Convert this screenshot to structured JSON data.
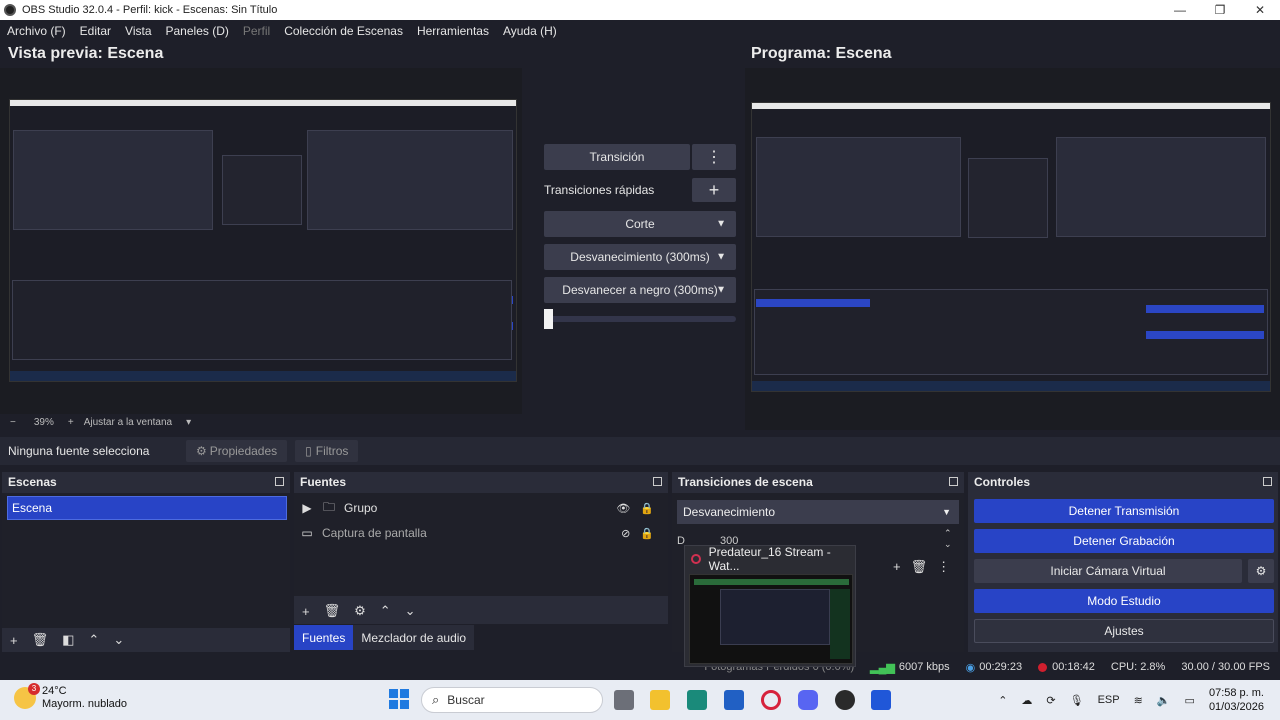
{
  "window": {
    "title": "OBS Studio 32.0.4 - Perfil: kick - Escenas: Sin Título",
    "controls": [
      "—",
      "❐",
      "✕"
    ]
  },
  "menu": [
    {
      "label": "Archivo (F)",
      "disabled": false
    },
    {
      "label": "Editar",
      "disabled": false
    },
    {
      "label": "Vista",
      "disabled": false
    },
    {
      "label": "Paneles (D)",
      "disabled": false
    },
    {
      "label": "Perfil",
      "disabled": true
    },
    {
      "label": "Colección de Escenas",
      "disabled": false
    },
    {
      "label": "Herramientas",
      "disabled": false
    },
    {
      "label": "Ayuda (H)",
      "disabled": false
    }
  ],
  "preview": {
    "title": "Vista previa: Escena"
  },
  "program": {
    "title": "Programa: Escena"
  },
  "transition_panel": {
    "transition_label": "Transición",
    "menu_icon": "⋮",
    "quick_label": "Transiciones rápidas",
    "add_icon": "+",
    "quick": [
      "Corte",
      "Desvanecimiento (300ms)",
      "Desvanecer a negro (300ms)"
    ]
  },
  "zoom": {
    "minus": "−",
    "value": "39%",
    "plus": "+",
    "fit_label": "Ajustar a la ventana",
    "chevron": "▾"
  },
  "source_bar": {
    "no_source": "Ninguna fuente selecciona",
    "properties": "Propiedades",
    "filters": "Filtros"
  },
  "docks": {
    "scenes": {
      "title": "Escenas",
      "items": [
        "Escena"
      ]
    },
    "sources": {
      "title": "Fuentes",
      "items": [
        {
          "label": "Grupo",
          "icon": "folder-icon"
        },
        {
          "label": "Captura de pantalla",
          "icon": "display-icon"
        }
      ]
    },
    "scene_transitions": {
      "title": "Transiciones de escena",
      "selected": "Desvanecimiento",
      "duration_label": "D",
      "duration_value": "300"
    },
    "controls": {
      "title": "Controles",
      "buttons": [
        "Detener Transmisión",
        "Detener Grabación",
        "Iniciar Cámara Virtual",
        "Modo Estudio",
        "Ajustes"
      ]
    },
    "tabs": [
      "Fuentes",
      "Mezclador de audio"
    ]
  },
  "popup": {
    "title": "Predateur_16 Stream - Wat..."
  },
  "status": {
    "dropped": "Fotogramas Perdidos 0 (0.0%)",
    "bitrate": "6007 kbps",
    "stream_time": "00:29:23",
    "rec_time": "00:18:42",
    "cpu": "CPU: 2.8%",
    "fps": "30.00 / 30.00 FPS"
  },
  "taskbar": {
    "weather_temp": "24°C",
    "weather_desc": "Mayorm. nublado",
    "weather_badge": "3",
    "search_placeholder": "Buscar",
    "lang": "ESP",
    "time": "07:58 p. m.",
    "date": "01/03/2026"
  },
  "colors": {
    "accent": "#2844c6",
    "background": "#1e1f29",
    "dock": "#2a2c39",
    "recording": "#d01f2e"
  }
}
